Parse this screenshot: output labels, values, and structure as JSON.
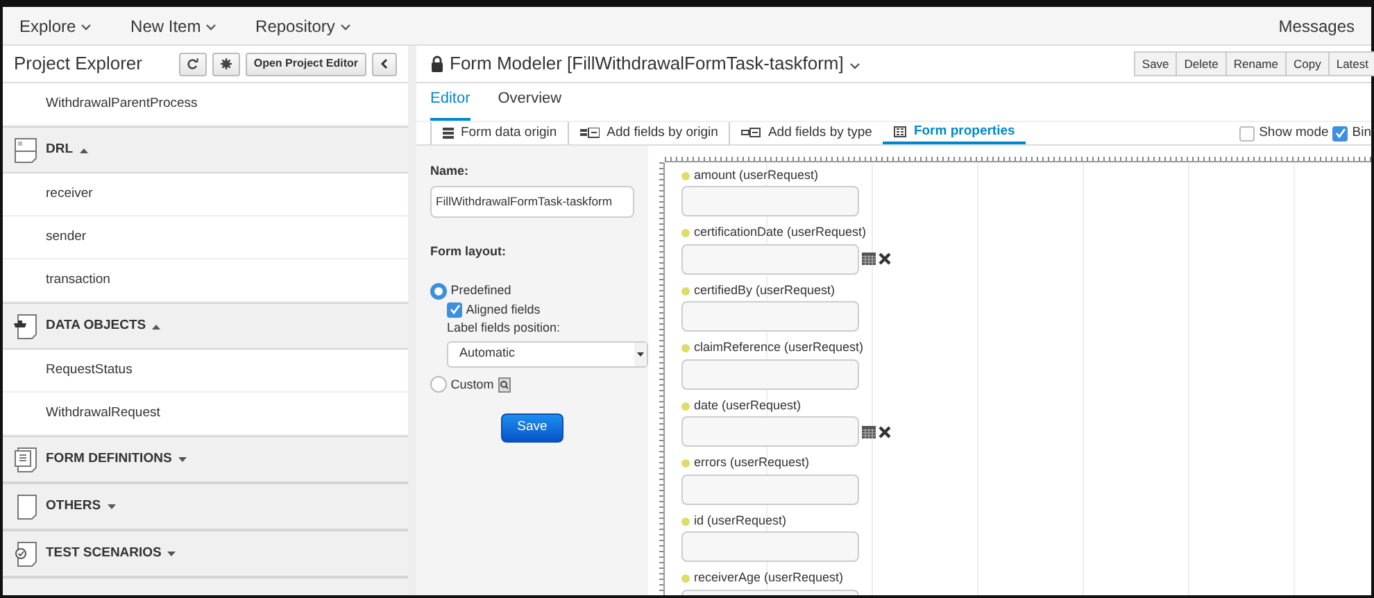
{
  "top_nav": {
    "menus": [
      "Explore",
      "New Item",
      "Repository"
    ],
    "right": "Messages"
  },
  "sidebar": {
    "title": "Project Explorer",
    "open_button": "Open Project Editor",
    "items_above": [
      "WithdrawalParentProcess"
    ],
    "sections": [
      {
        "title": "DRL",
        "expanded": true,
        "items": [
          "receiver",
          "sender",
          "transaction"
        ]
      },
      {
        "title": "DATA OBJECTS",
        "expanded": true,
        "items": [
          "RequestStatus",
          "WithdrawalRequest"
        ]
      },
      {
        "title": "FORM DEFINITIONS",
        "expanded": false
      },
      {
        "title": "OTHERS",
        "expanded": false
      },
      {
        "title": "TEST SCENARIOS",
        "expanded": false
      }
    ]
  },
  "editor": {
    "title": "Form Modeler [FillWithdrawalFormTask-taskform]",
    "buttons": [
      "Save",
      "Delete",
      "Rename",
      "Copy",
      "Latest"
    ],
    "tabs": [
      {
        "label": "Editor",
        "selected": true
      },
      {
        "label": "Overview",
        "selected": false
      }
    ],
    "toolbar": [
      {
        "label": "Form data origin",
        "selected": false
      },
      {
        "label": "Add fields by origin",
        "selected": false
      },
      {
        "label": "Add fields by type",
        "selected": false
      },
      {
        "label": "Form properties",
        "selected": true
      }
    ],
    "options": [
      {
        "label": "Show mode",
        "checked": false
      },
      {
        "label": "Bin",
        "checked": true
      }
    ]
  },
  "properties": {
    "name_label": "Name:",
    "name_value": "FillWithdrawalFormTask-taskform",
    "layout_label": "Form layout:",
    "layouts": [
      {
        "label": "Predefined",
        "selected": true
      },
      {
        "label": "Custom",
        "selected": false
      }
    ],
    "aligned": {
      "label": "Aligned fields",
      "checked": true
    },
    "position_label": "Label fields position:",
    "position_value": "Automatic",
    "save": "Save"
  },
  "fields": [
    {
      "label": "amount (userRequest)",
      "kind": "text"
    },
    {
      "label": "certificationDate (userRequest)",
      "kind": "date"
    },
    {
      "label": "certifiedBy (userRequest)",
      "kind": "text"
    },
    {
      "label": "claimReference (userRequest)",
      "kind": "text"
    },
    {
      "label": "date (userRequest)",
      "kind": "date"
    },
    {
      "label": "errors (userRequest)",
      "kind": "text"
    },
    {
      "label": "id (userRequest)",
      "kind": "text"
    },
    {
      "label": "receiverAge (userRequest)",
      "kind": "text"
    }
  ]
}
